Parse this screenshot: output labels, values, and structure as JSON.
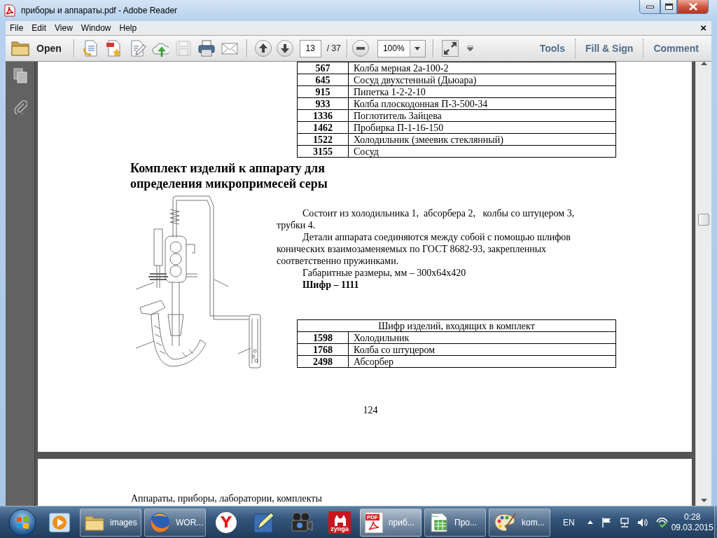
{
  "window": {
    "title": "приборы и аппараты.pdf - Adobe Reader"
  },
  "menu": {
    "items": [
      "File",
      "Edit",
      "View",
      "Window",
      "Help"
    ],
    "close": "×"
  },
  "toolbar": {
    "open": "Open",
    "tools": [
      {
        "kind": "create",
        "disabled": false
      },
      {
        "kind": "export",
        "disabled": false
      },
      {
        "kind": "sign",
        "disabled": false
      },
      {
        "kind": "upload",
        "disabled": false
      },
      {
        "kind": "save",
        "disabled": true
      },
      {
        "kind": "print",
        "disabled": false
      },
      {
        "kind": "mail",
        "disabled": false
      }
    ],
    "page_number": "13",
    "page_count": "/ 37",
    "zoom": "100%",
    "panes": [
      "Tools",
      "Fill & Sign",
      "Comment"
    ]
  },
  "document": {
    "parts_table": {
      "rows": [
        {
          "code": "567",
          "name": "Колба мерная 2а-100-2"
        },
        {
          "code": "645",
          "name": "Сосуд двухстенный (Дьюара)"
        },
        {
          "code": "915",
          "name": "Пипетка 1-2-2-10"
        },
        {
          "code": "933",
          "name": "Колба плоскодонная П-3-500-34"
        },
        {
          "code": "1336",
          "name": "Поглотитель Зайцева"
        },
        {
          "code": "1462",
          "name": "Пробирка П-1-16-150"
        },
        {
          "code": "1522",
          "name": "Холодильник (змеевик стеклянный)"
        },
        {
          "code": "3155",
          "name": "Сосуд"
        }
      ]
    },
    "heading": "Комплект изделий к аппарату для определения микропримесей серы",
    "paragraphs": [
      {
        "kind": "text",
        "text": "Состоит из холодильника 1,  абсорбера 2,   колбы со штуцером 3, трубки 4."
      },
      {
        "kind": "text",
        "text": "Детали аппарата соединяются между собой с помощью шлифов конических взаимозаменяемых по ГОСТ 8682-93, закрепленных соответственно пружинками."
      },
      {
        "kind": "text",
        "text": "Габаритные размеры, мм – 300x64x420"
      },
      {
        "kind": "cipher",
        "text": "Шифр – 1111"
      }
    ],
    "kit_table": {
      "title": "Шифр изделий, входящих в комплект",
      "rows": [
        {
          "code": "1598",
          "name": "Холодильник"
        },
        {
          "code": "1768",
          "name": "Колба со штуцером"
        },
        {
          "code": "2498",
          "name": "Абсорбер"
        }
      ]
    },
    "page_number": "124",
    "next_page_text": "Аппараты, приборы, лаборатории, комплекты"
  },
  "taskbar": {
    "items": [
      {
        "kind": "media",
        "running": false,
        "selected": false
      },
      {
        "kind": "folder",
        "label": "images",
        "running": true,
        "selected": false
      },
      {
        "kind": "browser",
        "label": "WOR...",
        "running": true,
        "selected": false
      },
      {
        "kind": "yandex",
        "logo_text": "Y",
        "running": false,
        "selected": false
      },
      {
        "kind": "pen",
        "running": false,
        "selected": false
      },
      {
        "kind": "camera",
        "running": false,
        "selected": false
      },
      {
        "kind": "zynga",
        "logo_text": "zynga",
        "running": false,
        "selected": false
      },
      {
        "kind": "pdf",
        "logo_text": "PDF",
        "label": "приб...",
        "running": true,
        "selected": true
      },
      {
        "kind": "sheet",
        "label": "Про...",
        "running": true,
        "selected": false
      },
      {
        "kind": "palette",
        "label": "kom...",
        "running": true,
        "selected": false
      }
    ],
    "language": "EN",
    "time": "0:28",
    "date": "09.03.2015"
  }
}
